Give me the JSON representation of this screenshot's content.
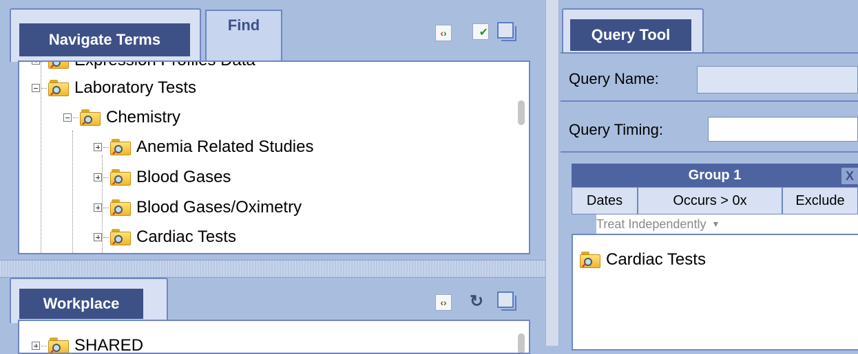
{
  "navigate_panel": {
    "tabs": {
      "navigate": "Navigate Terms",
      "find": "Find"
    },
    "toolbar_icons": [
      "xml-export-icon",
      "check-list-icon",
      "maximize-window-icon"
    ],
    "tree": {
      "partial_top": "Expression Profiles Data",
      "items": [
        {
          "label": "Laboratory Tests",
          "expander": "minus"
        },
        {
          "label": "Chemistry",
          "expander": "minus"
        },
        {
          "label": "Anemia Related Studies",
          "expander": "plus"
        },
        {
          "label": "Blood Gases",
          "expander": "plus"
        },
        {
          "label": "Blood Gases/Oximetry",
          "expander": "plus"
        },
        {
          "label": "Cardiac Tests",
          "expander": "plus"
        }
      ]
    }
  },
  "workplace_panel": {
    "tab": "Workplace",
    "toolbar_icons": [
      "xml-export-icon",
      "refresh-icon",
      "maximize-window-icon"
    ],
    "tree": {
      "partial_item": "SHARED"
    }
  },
  "query_tool": {
    "tab": "Query Tool",
    "query_name_label": "Query Name:",
    "query_name_value": "",
    "query_timing_label": "Query Timing:",
    "query_timing_value": "",
    "group": {
      "title": "Group 1",
      "close": "X",
      "dates": "Dates",
      "occurs": "Occurs > 0x",
      "exclude": "Exclude",
      "treat": "Treat Independently",
      "items": [
        "Cardiac Tests"
      ]
    }
  },
  "colors": {
    "accent": "#3e5187",
    "panel_bg": "#a9bedf",
    "border": "#6e86c0"
  }
}
